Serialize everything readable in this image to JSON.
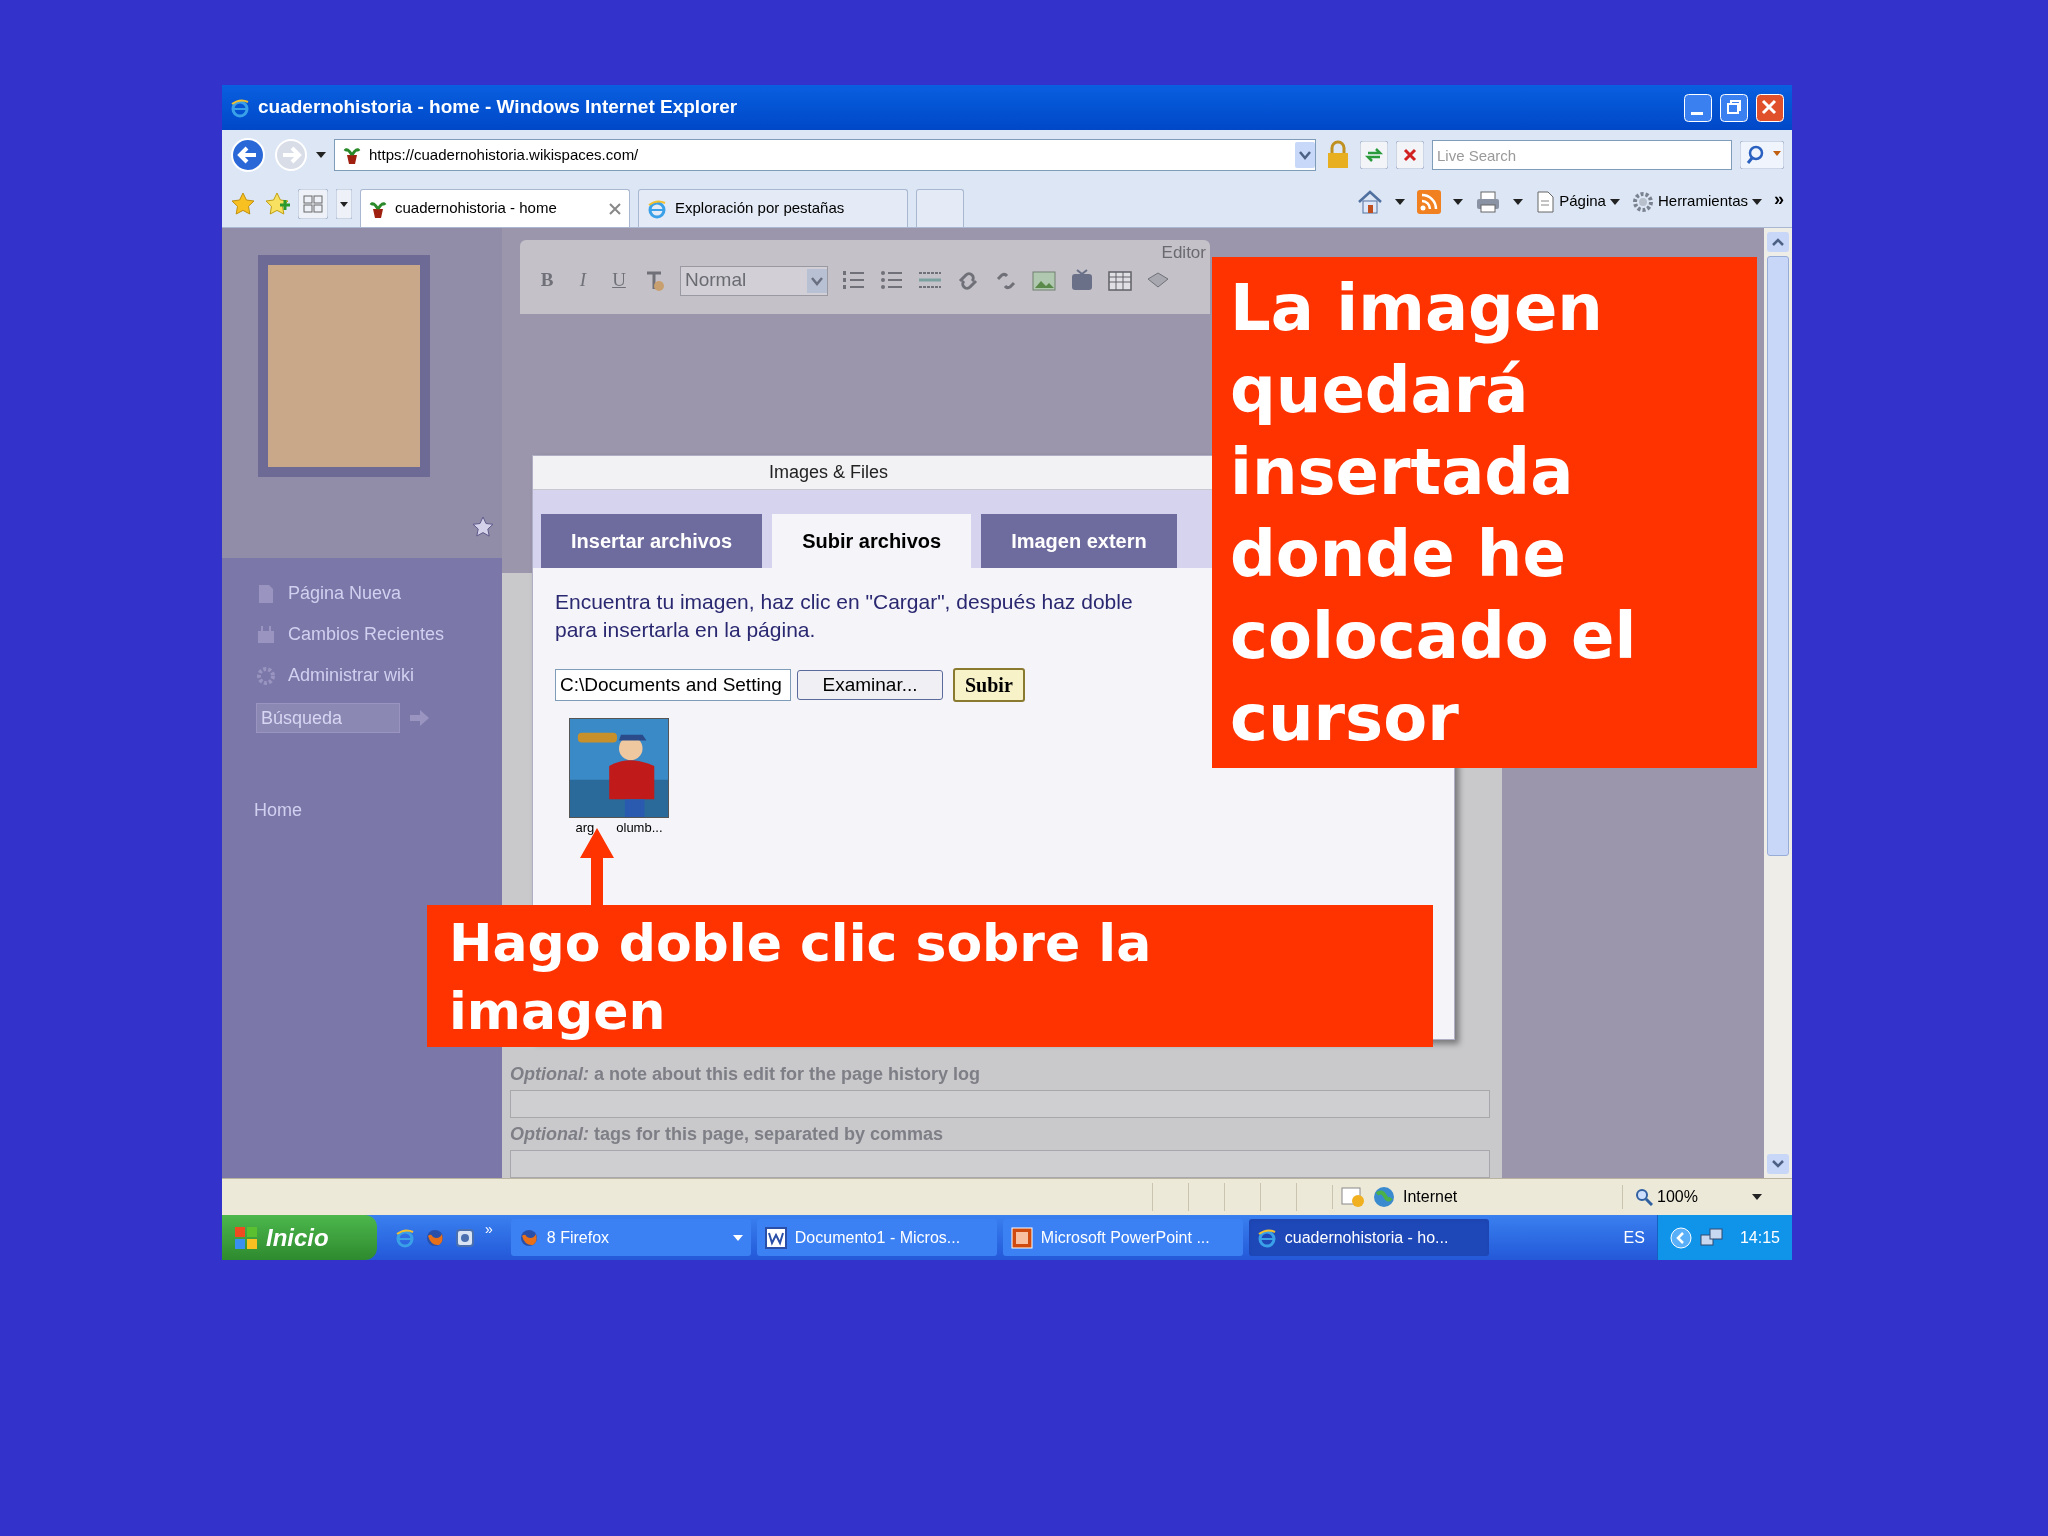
{
  "window": {
    "title": "cuadernohistoria - home - Windows Internet Explorer"
  },
  "address_bar": {
    "url": "https://cuadernohistoria.wikispaces.com/",
    "search_placeholder": "Live Search"
  },
  "tabs": [
    {
      "label": "cuadernohistoria - home",
      "selected": true
    },
    {
      "label": "Exploración por pestañas",
      "selected": false
    }
  ],
  "command_bar": {
    "items": [
      "Página",
      "Herramientas"
    ],
    "more": "»"
  },
  "editor": {
    "title": "Editor",
    "buttons": [
      "B",
      "I",
      "U"
    ],
    "format": "Normal"
  },
  "sidebar": {
    "nav": [
      "Página Nueva",
      "Cambios Recientes",
      "Administrar wiki"
    ],
    "search_placeholder": "Búsqueda",
    "links": [
      "Home"
    ]
  },
  "dialog": {
    "title": "Images & Files",
    "tabs": [
      {
        "label": "Insertar archivos",
        "selected": false
      },
      {
        "label": "Subir archivos",
        "selected": true
      },
      {
        "label": "Imagen extern",
        "selected": false
      }
    ],
    "instructions": "Encuentra tu imagen, haz clic en \"Cargar\", después haz doble\npara insertarla en la página.",
    "file_path": "C:\\Documents and Setting",
    "browse": "Examinar...",
    "upload": "Subir",
    "thumbnail_caption": [
      "arg",
      "olumb..."
    ]
  },
  "form": {
    "fields": [
      "*Optional:* a note about this edit for the page history log",
      "*Optional:* tags for this page, separated by commas"
    ]
  },
  "status_bar": {
    "zone": "Internet",
    "zoom": "100%"
  },
  "taskbar": {
    "start": "Inicio",
    "quick_launch_more": "»",
    "buttons": [
      {
        "kind": "firefox",
        "label": "8 Firefox",
        "selected": false
      },
      {
        "kind": "word",
        "label": "Documento1 - Micros...",
        "selected": false
      },
      {
        "kind": "powerpoint",
        "label": "Microsoft PowerPoint ...",
        "selected": false
      },
      {
        "kind": "browser",
        "label": "cuadernohistoria - ho...",
        "selected": true
      }
    ],
    "language": "ES",
    "clock": "14:15"
  },
  "callouts": [
    {
      "text": "La imagen quedará insertada donde he colocado el cursor"
    },
    {
      "text": "Hago doble clic sobre la imagen"
    }
  ]
}
